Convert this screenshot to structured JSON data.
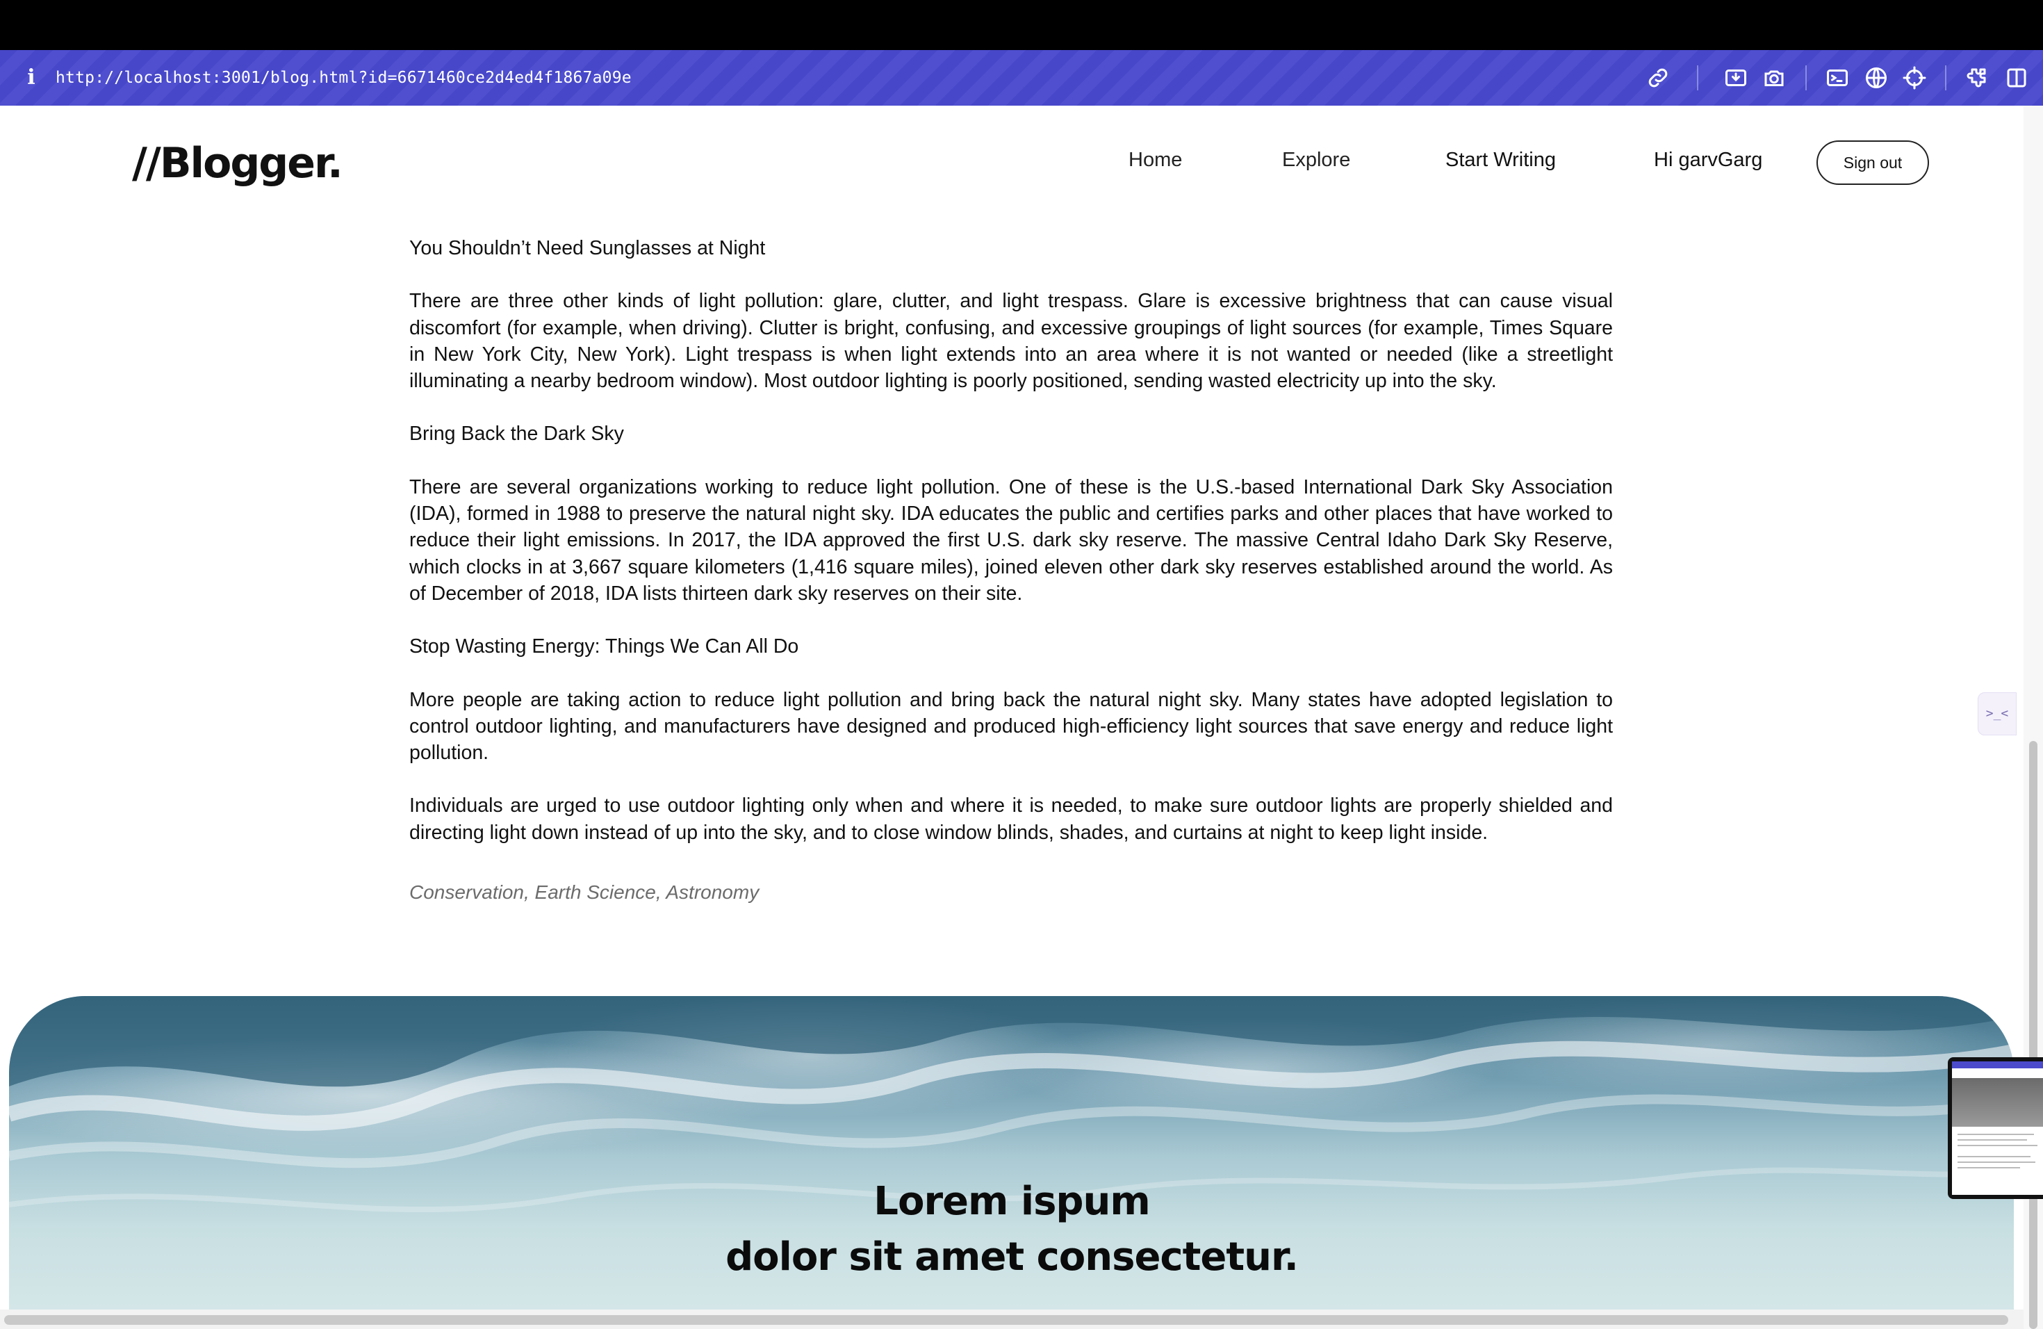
{
  "browser": {
    "url": "http://localhost:3001/blog.html?id=6671460ce2d4ed4f1867a09e",
    "toolbar_icons": [
      "link-icon",
      "download-icon",
      "camera-icon",
      "terminal-icon",
      "globe-icon",
      "crosshair-icon",
      "extension-icon",
      "split-view-icon"
    ],
    "accent_color": "#4b4bcc"
  },
  "nav": {
    "logo": "//Blogger.",
    "links": [
      "Home",
      "Explore",
      "Start Writing",
      "Hi garvGarg"
    ],
    "signout_label": "Sign out"
  },
  "article": {
    "sections": [
      {
        "heading": "You Shouldn’t Need Sunglasses at Night"
      },
      {
        "paragraph": "There are three other kinds of light pollution: glare, clutter, and light trespass. Glare is excessive brightness that can cause visual discomfort (for example, when driving). Clutter is bright, confusing, and excessive groupings of light sources (for example, Times Square in New York City, New York). Light trespass is when light extends into an area where it is not wanted or needed (like a streetlight illuminating a nearby bedroom window). Most outdoor lighting is poorly positioned, sending wasted electricity up into the sky."
      },
      {
        "heading": "Bring Back the Dark Sky"
      },
      {
        "paragraph": "There are several organizations working to reduce light pollution. One of these is the U.S.-based International Dark Sky Association (IDA), formed in 1988 to preserve the natural night sky. IDA educates the public and certifies parks and other places that have worked to reduce their light emissions. In 2017, the IDA approved the first U.S. dark sky reserve. The massive Central Idaho Dark Sky Reserve, which clocks in at 3,667 square kilometers (1,416 square miles), joined eleven other dark sky reserves established around the world. As of December of 2018, IDA lists thirteen dark sky reserves on their site."
      },
      {
        "heading": "Stop Wasting Energy: Things We Can All Do"
      },
      {
        "paragraph": "More people are taking action to reduce light pollution and bring back the natural night sky. Many states have adopted legislation to control outdoor lighting, and manufacturers have designed and produced high-efficiency light sources that save energy and reduce light pollution."
      },
      {
        "paragraph": "Individuals are urged to use outdoor lighting only when and where it is needed, to make sure outdoor lights are properly shielded and directing light down instead of up into the sky, and to close window blinds, shades, and curtains at night to keep light inside."
      }
    ],
    "tags": "Conservation, Earth Science, Astronomy"
  },
  "hero": {
    "line1": "Lorem ispum",
    "line2": "dolor sit amet consectetur."
  },
  "side_tab": {
    "glyph": ">_<"
  }
}
